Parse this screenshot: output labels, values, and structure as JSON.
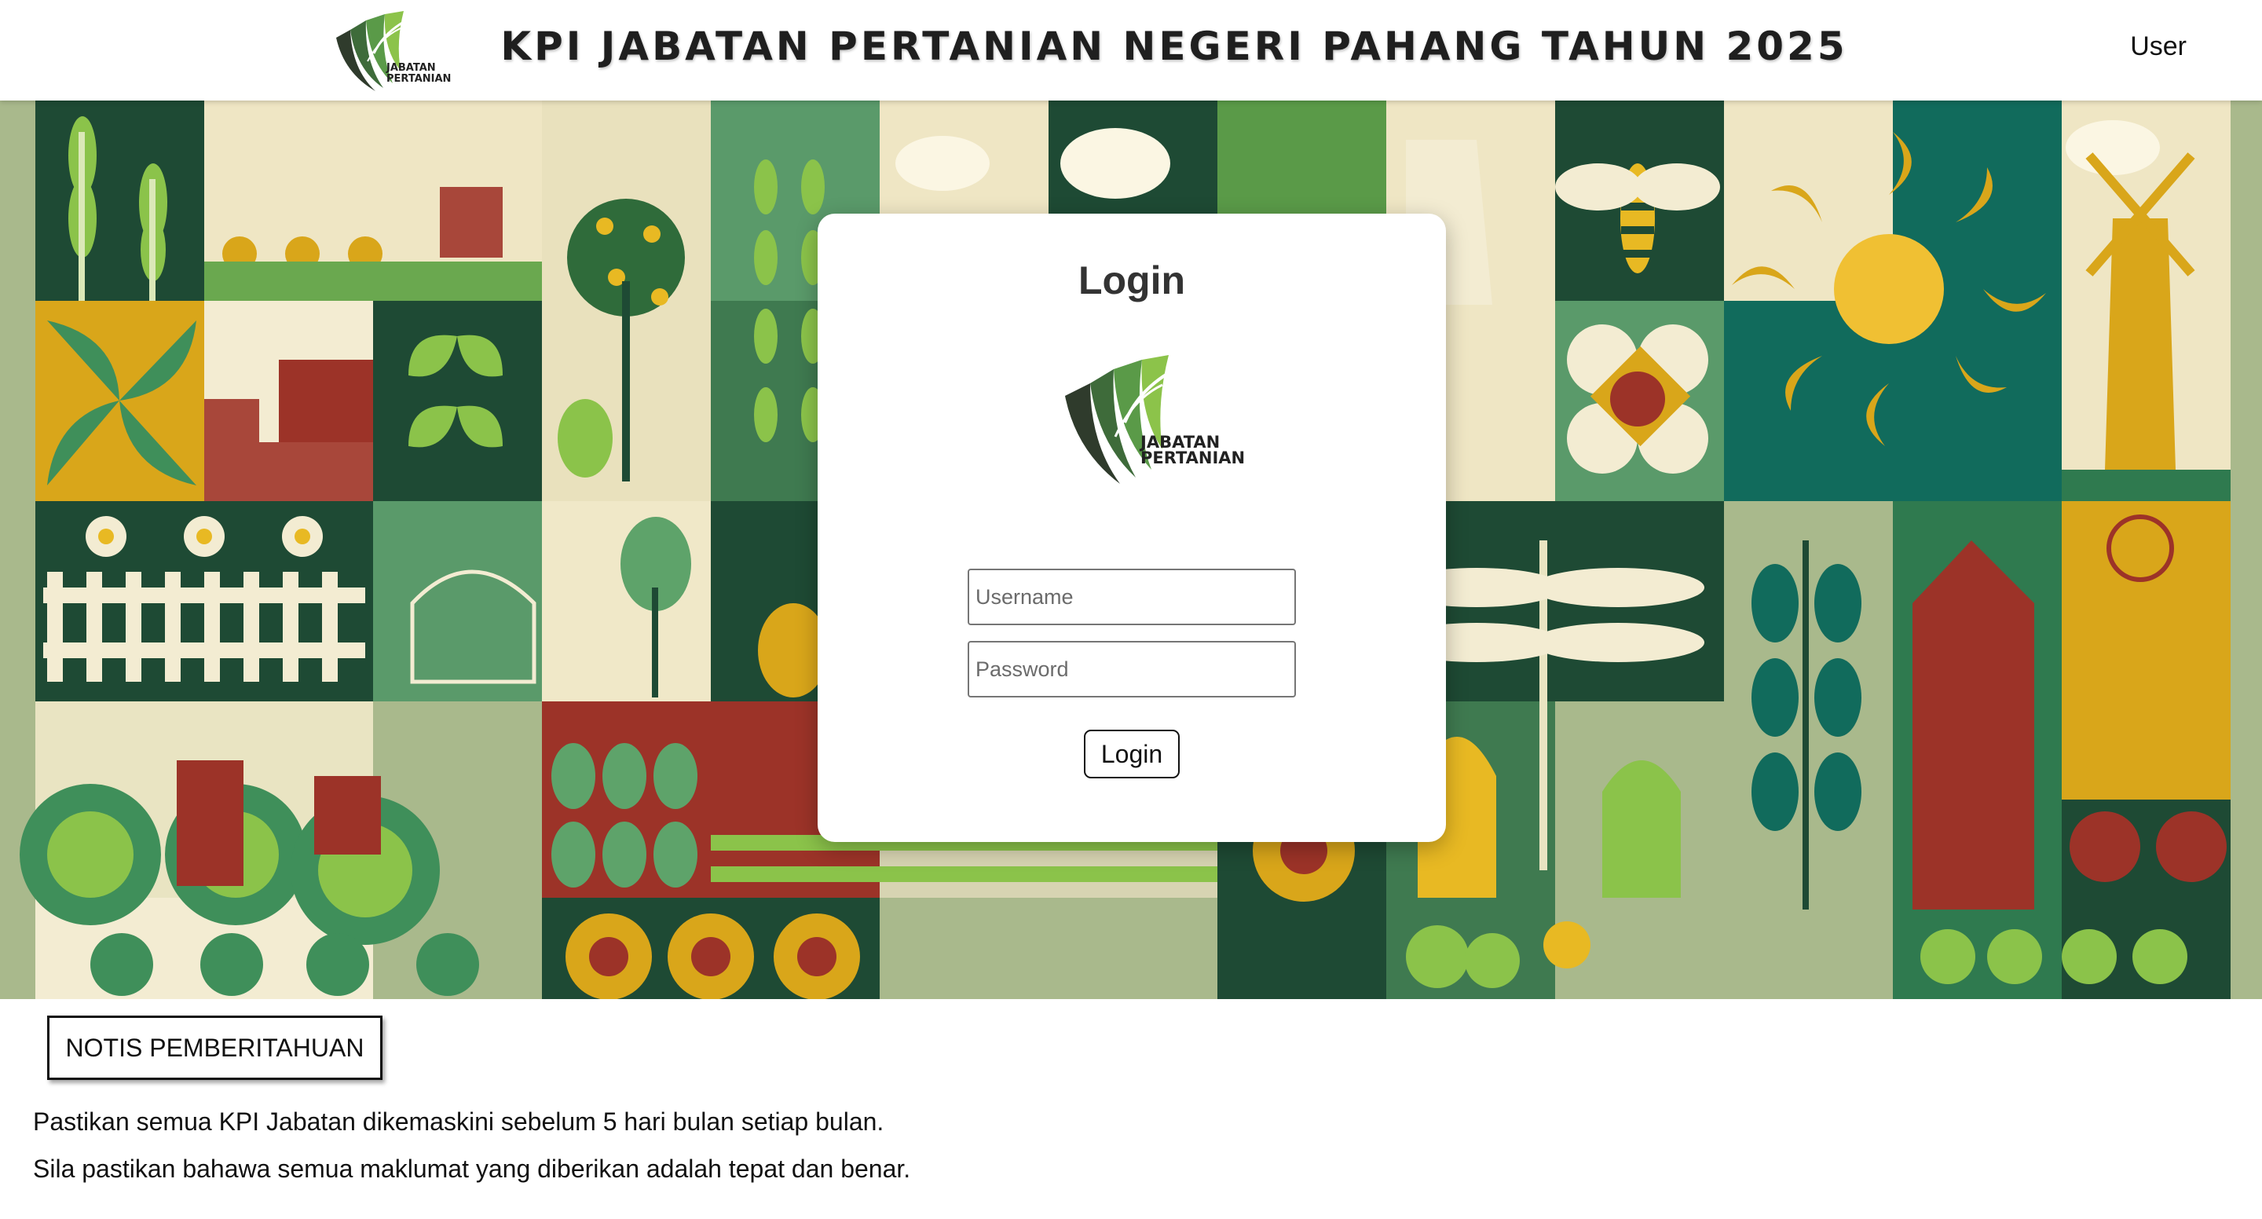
{
  "header": {
    "title": "KPI JABATAN PERTANIAN NEGERI PAHANG TAHUN 2025",
    "user_label": "User",
    "logo_text_line1": "JABATAN",
    "logo_text_line2": "PERTANIAN"
  },
  "login": {
    "title": "Login",
    "username_placeholder": "Username",
    "password_placeholder": "Password",
    "button_label": "Login",
    "logo_text_line1": "JABATAN",
    "logo_text_line2": "PERTANIAN"
  },
  "notice": {
    "button_label": "NOTIS PEMBERITAHUAN",
    "lines": [
      "Pastikan semua KPI Jabatan dikemaskini sebelum 5 hari bulan setiap bulan.",
      "Sila pastikan bahawa semua maklumat yang diberikan adalah tepat dan benar."
    ]
  },
  "colors": {
    "dark_green": "#1e4a34",
    "mid_green": "#3f8f5a",
    "light_green": "#8bc34a",
    "sage": "#a9b98c",
    "cream": "#f3ecd2",
    "mustard": "#d9a61a",
    "brick_red": "#9c3328"
  },
  "icons": [
    "department-logo",
    "banner-illustration"
  ]
}
